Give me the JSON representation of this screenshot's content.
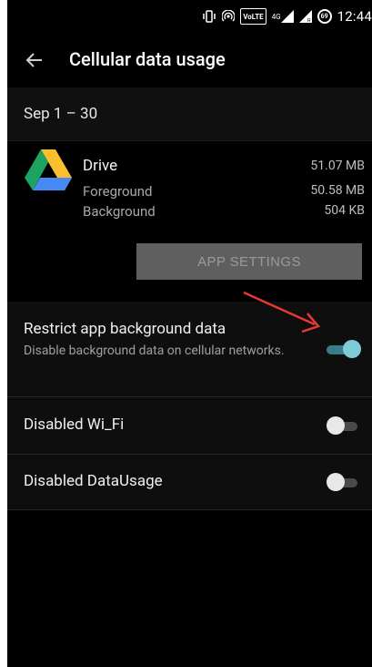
{
  "status_bar": {
    "icons": [
      "vibrate-icon",
      "hotspot-icon",
      "volte-icon",
      "signal-4g-icon",
      "signal-r-icon",
      "battery-icon"
    ],
    "volte_label": "VoLTE",
    "network_label": "4G",
    "battery_level": "69",
    "time": "12:44"
  },
  "app_bar": {
    "title": "Cellular data usage",
    "back_icon": "arrow-left-icon"
  },
  "period": {
    "label": "Sep 1 – 30"
  },
  "app": {
    "name": "Drive",
    "icon": "google-drive-icon",
    "total": "51.07 MB",
    "foreground_label": "Foreground",
    "foreground_value": "50.58 MB",
    "background_label": "Background",
    "background_value": "504 KB",
    "settings_button": "APP SETTINGS"
  },
  "settings": [
    {
      "title": "Restrict app background data",
      "subtitle": "Disable background data on cellular networks.",
      "enabled": true
    },
    {
      "title": "Disabled Wi_Fi",
      "enabled": false
    },
    {
      "title": "Disabled DataUsage",
      "enabled": false
    }
  ],
  "colors": {
    "background": "#000000",
    "toggle_on_thumb": "#80cbd6",
    "toggle_on_track": "#3a7d8a",
    "annotation_arrow": "#e53935"
  }
}
